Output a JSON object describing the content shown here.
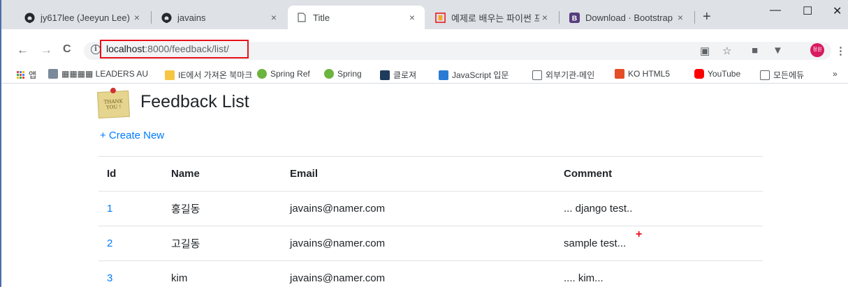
{
  "browser": {
    "tabs": [
      {
        "title": "jy617lee (Jeeyun Lee)",
        "icon": "github-icon",
        "active": false
      },
      {
        "title": "javains",
        "icon": "github-icon",
        "active": false
      },
      {
        "title": "Title",
        "icon": "page-icon",
        "active": true
      },
      {
        "title": "예제로 배우는 파이썬 프",
        "icon": "python-site-icon",
        "active": false
      },
      {
        "title": "Download · Bootstrap",
        "icon": "bootstrap-icon",
        "active": false
      }
    ],
    "tab_close": "×",
    "new_tab": "+",
    "window_controls": {
      "minimize": "—",
      "maximize": "☐",
      "close": "✕"
    }
  },
  "toolbar": {
    "back": "←",
    "forward": "→",
    "reload": "C",
    "url_host": "localhost",
    "url_path": ":8000/feedback/list/",
    "highlight_color": "#e8101a"
  },
  "bookmarks": [
    {
      "label": "앱",
      "icon": "apps-grid-icon"
    },
    {
      "label": "▦▦▦▦ LEADERS AU",
      "icon": "leaders-icon"
    },
    {
      "label": "IE에서 가져온 북마크",
      "icon": "folder-icon"
    },
    {
      "label": "Spring Ref",
      "icon": "spring-icon"
    },
    {
      "label": "Spring",
      "icon": "spring-icon"
    },
    {
      "label": "클로져",
      "icon": "clojure-icon"
    },
    {
      "label": "JavaScript 입문",
      "icon": "js-icon"
    },
    {
      "label": "외부기관-메인",
      "icon": "page-icon"
    },
    {
      "label": "KO HTML5",
      "icon": "html5-icon"
    },
    {
      "label": "YouTube",
      "icon": "youtube-icon"
    },
    {
      "label": "모든에듀",
      "icon": "page-icon"
    }
  ],
  "bookmarks_more": "»",
  "page": {
    "image_text": "THANK YOU !",
    "title": "Feedback List",
    "create_link": "+ Create New",
    "table": {
      "headers": [
        "Id",
        "Name",
        "Email",
        "Comment"
      ],
      "rows": [
        {
          "id": "1",
          "name": "홍길동",
          "email": "javains@namer.com",
          "comment": "... django test.."
        },
        {
          "id": "2",
          "name": "고길동",
          "email": "javains@namer.com",
          "comment": "sample test..."
        },
        {
          "id": "3",
          "name": "kim",
          "email": "javains@namer.com",
          "comment": ".... kim..."
        }
      ]
    }
  },
  "colors": {
    "link": "#007bff",
    "accent_red": "#e8101a",
    "youtube": "#ff0000",
    "bootstrap": "#563d7c"
  }
}
